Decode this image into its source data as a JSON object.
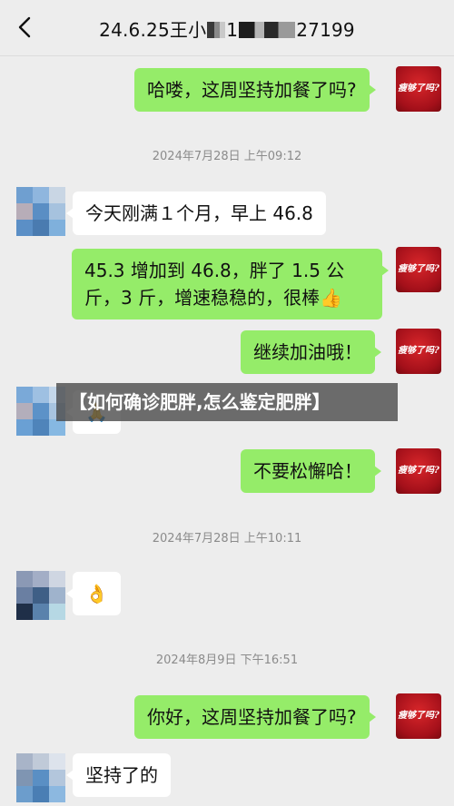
{
  "header": {
    "title_prefix": "24.6.25王小",
    "title_mid": "1",
    "title_suffix": "27199"
  },
  "icons": {
    "back": "chevron-left-icon",
    "thumbs": "thumbs-up-emoji",
    "ok": "ok-hand-emoji",
    "pray": "folded-hands-emoji"
  },
  "self_avatar_text": "瘦够了吗?",
  "colors": {
    "bg": "#ededed",
    "self_bubble": "#95ec69",
    "other_bubble": "#ffffff",
    "timestamp": "#8b8b8b",
    "avatar_red": "#c11a21"
  },
  "messages": [
    {
      "from": "self",
      "text": "哈喽，这周坚持加餐了吗?"
    },
    {
      "type": "timestamp",
      "text": "2024年7月28日 上午09:12"
    },
    {
      "from": "other",
      "text": "今天刚满１个月，早上 46.8"
    },
    {
      "from": "self",
      "text": "45.3 增加到 46.8，胖了 1.5 公斤，3 斤，增速稳稳的，很棒👍"
    },
    {
      "from": "self",
      "text": "继续加油哦！"
    },
    {
      "from": "other",
      "text": "🙏"
    },
    {
      "from": "self",
      "text": "不要松懈哈！"
    },
    {
      "type": "timestamp",
      "text": "2024年7月28日 上午10:11"
    },
    {
      "from": "other",
      "text": "👌"
    },
    {
      "type": "timestamp",
      "text": "2024年8月9日 下午16:51"
    },
    {
      "from": "self",
      "text": "你好，这周坚持加餐了吗?"
    },
    {
      "from": "other",
      "text": "坚持了的"
    }
  ],
  "overlay_banner": "【如何确诊肥胖,怎么鉴定肥胖】"
}
